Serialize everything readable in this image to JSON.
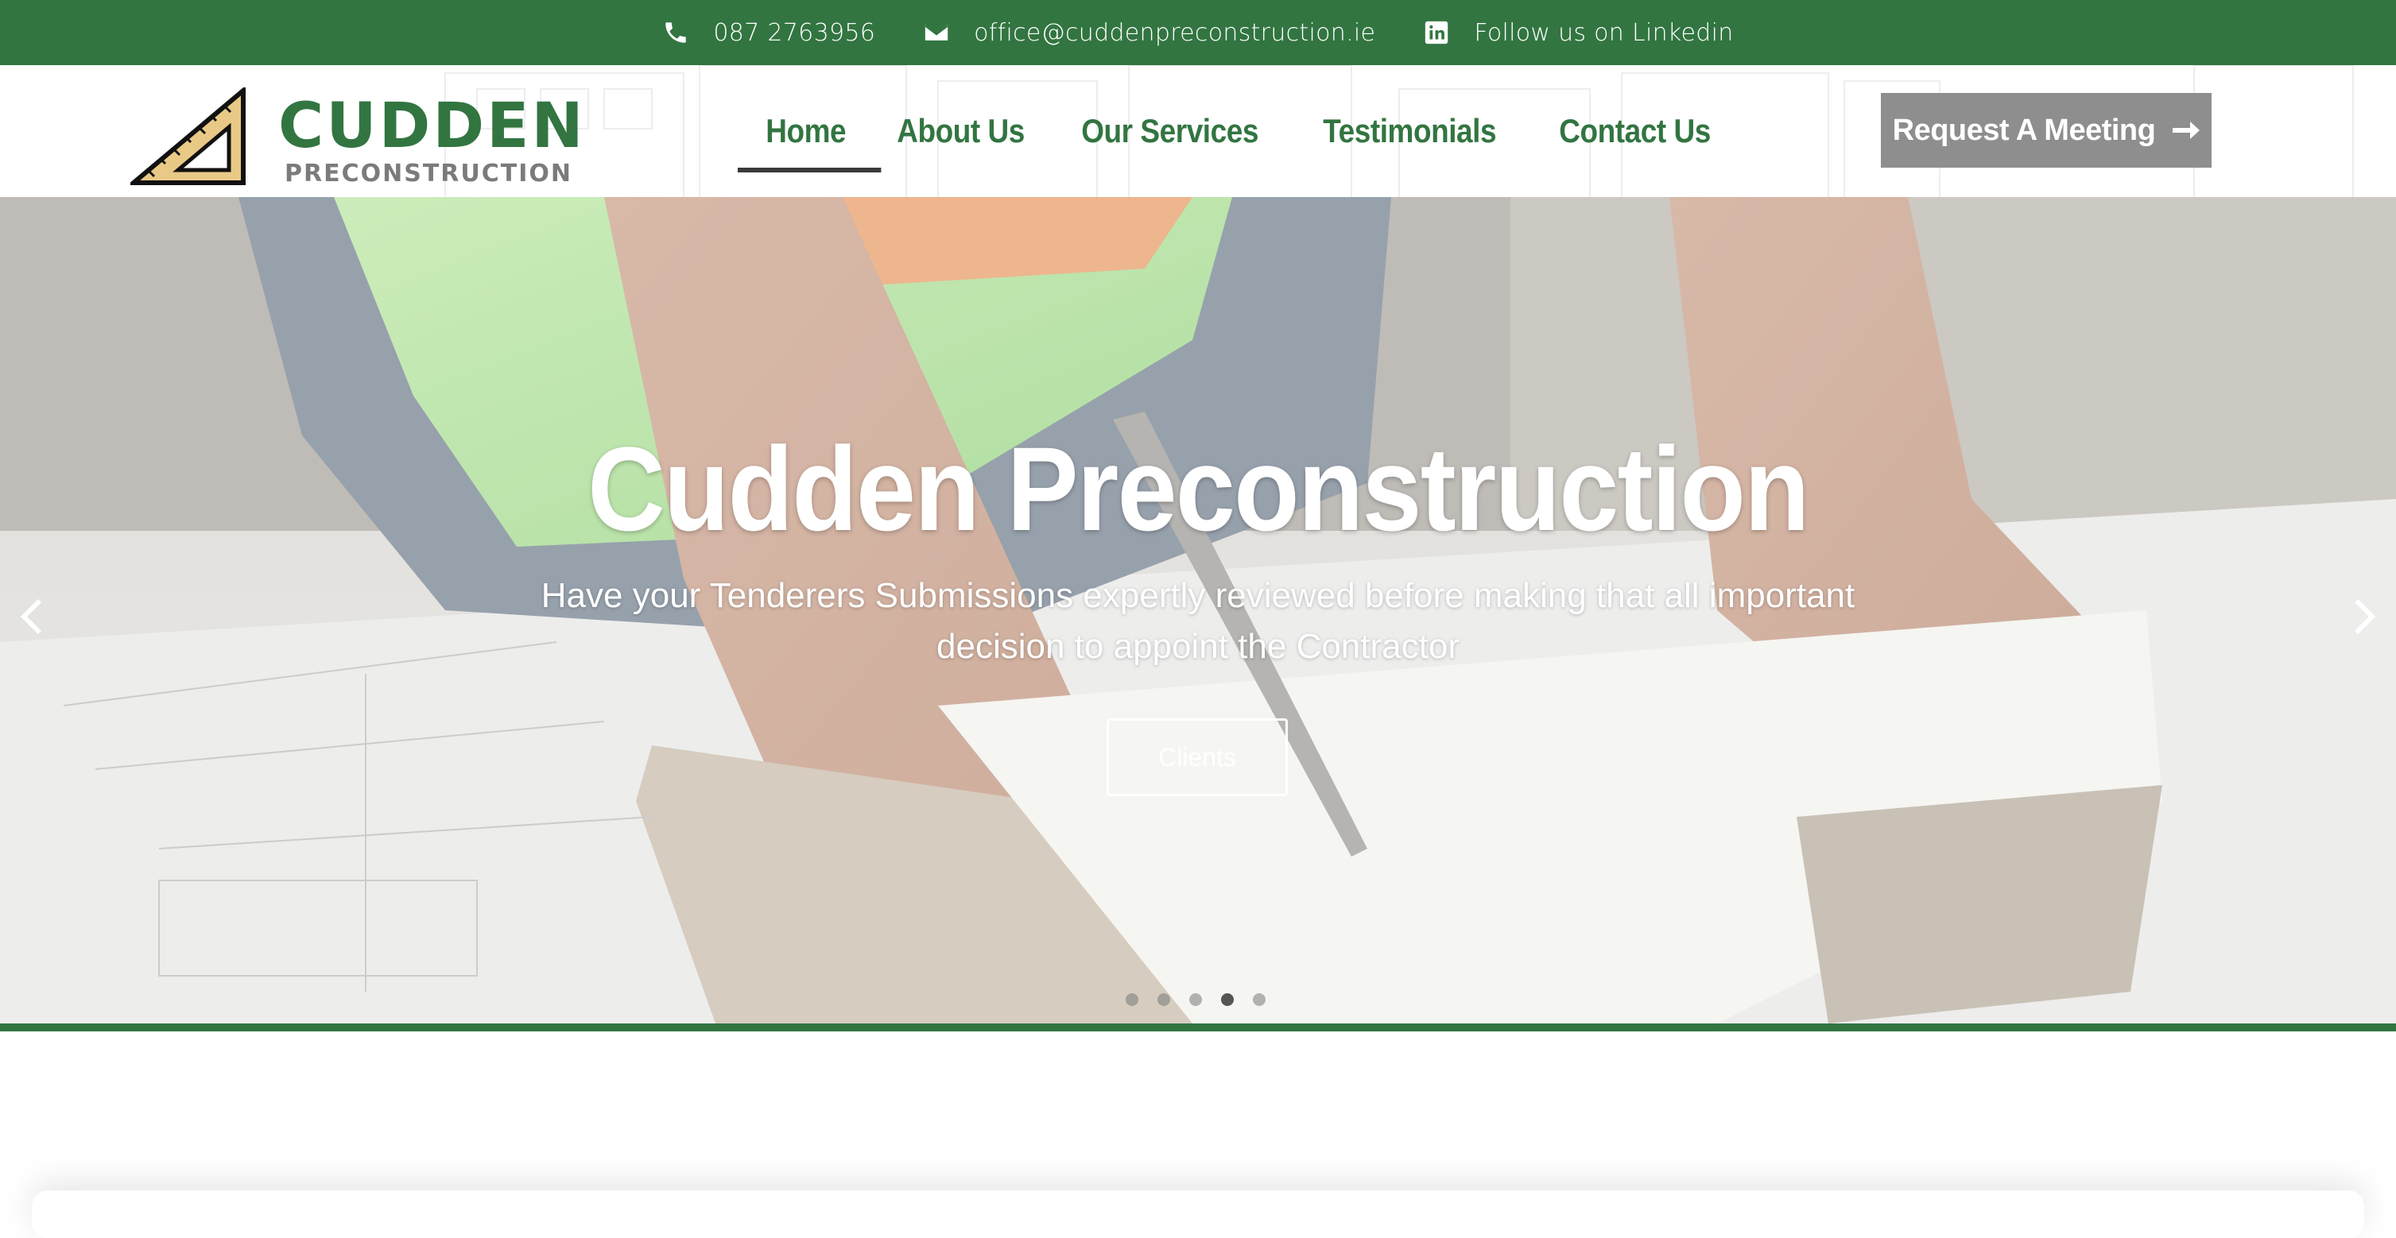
{
  "topbar": {
    "phone": "087 2763956",
    "email": "office@cuddenpreconstruction.ie",
    "linkedin": "Follow us on Linkedin",
    "icons": [
      "phone-icon",
      "envelope-icon",
      "linkedin-icon"
    ]
  },
  "logo": {
    "main": "CUDDEN",
    "sub": "PRECONSTRUCTION"
  },
  "nav": {
    "items": [
      {
        "label": "Home",
        "active": true
      },
      {
        "label": "About Us"
      },
      {
        "label": "Our Services"
      },
      {
        "label": "Testimonials"
      },
      {
        "label": "Contact Us"
      }
    ]
  },
  "cta": {
    "label": "Request A Meeting"
  },
  "hero": {
    "title": "Cudden Preconstruction",
    "subtitle": "Have your Tenderers Submissions expertly reviewed before making that all important decision to appoint the Contractor",
    "button": "Clients",
    "slides_count": 5,
    "active_slide": 4
  },
  "colors": {
    "brand_green": "#327541",
    "cta_gray": "#8e8e8e",
    "logo_gold": "#e9c986"
  }
}
